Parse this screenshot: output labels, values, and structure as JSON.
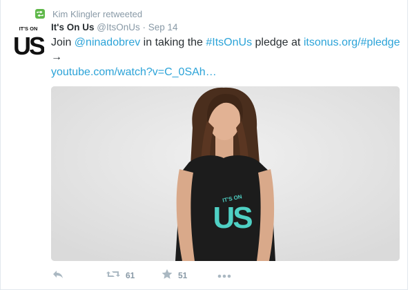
{
  "context": {
    "retweeter": "Kim Klingler retweeted",
    "icon": "retweet-icon",
    "accent": "#5fb84a"
  },
  "tweet": {
    "avatar": {
      "top_text": "IT'S ON",
      "big_text": "US"
    },
    "fullname": "It's On Us",
    "username": "@ItsOnUs",
    "separator": "·",
    "time": "Sep 14",
    "text": {
      "part1": "Join ",
      "mention": "@ninadobrev",
      "part2": " in taking the ",
      "hashtag": "#ItsOnUs",
      "part3": " pledge at ",
      "url": "itsonus.org/#pledge",
      "arrow": "→"
    },
    "link": "youtube.com/watch?v=C_0SAh…",
    "shirt": {
      "top_text": "IT'S ON",
      "big_text": "US"
    },
    "link_color": "#2ba3d8"
  },
  "actions": {
    "reply_icon": "reply-icon",
    "retweet_icon": "retweet-icon",
    "retweet_count": "61",
    "favorite_icon": "star-icon",
    "favorite_count": "51",
    "more_icon": "more-icon"
  }
}
